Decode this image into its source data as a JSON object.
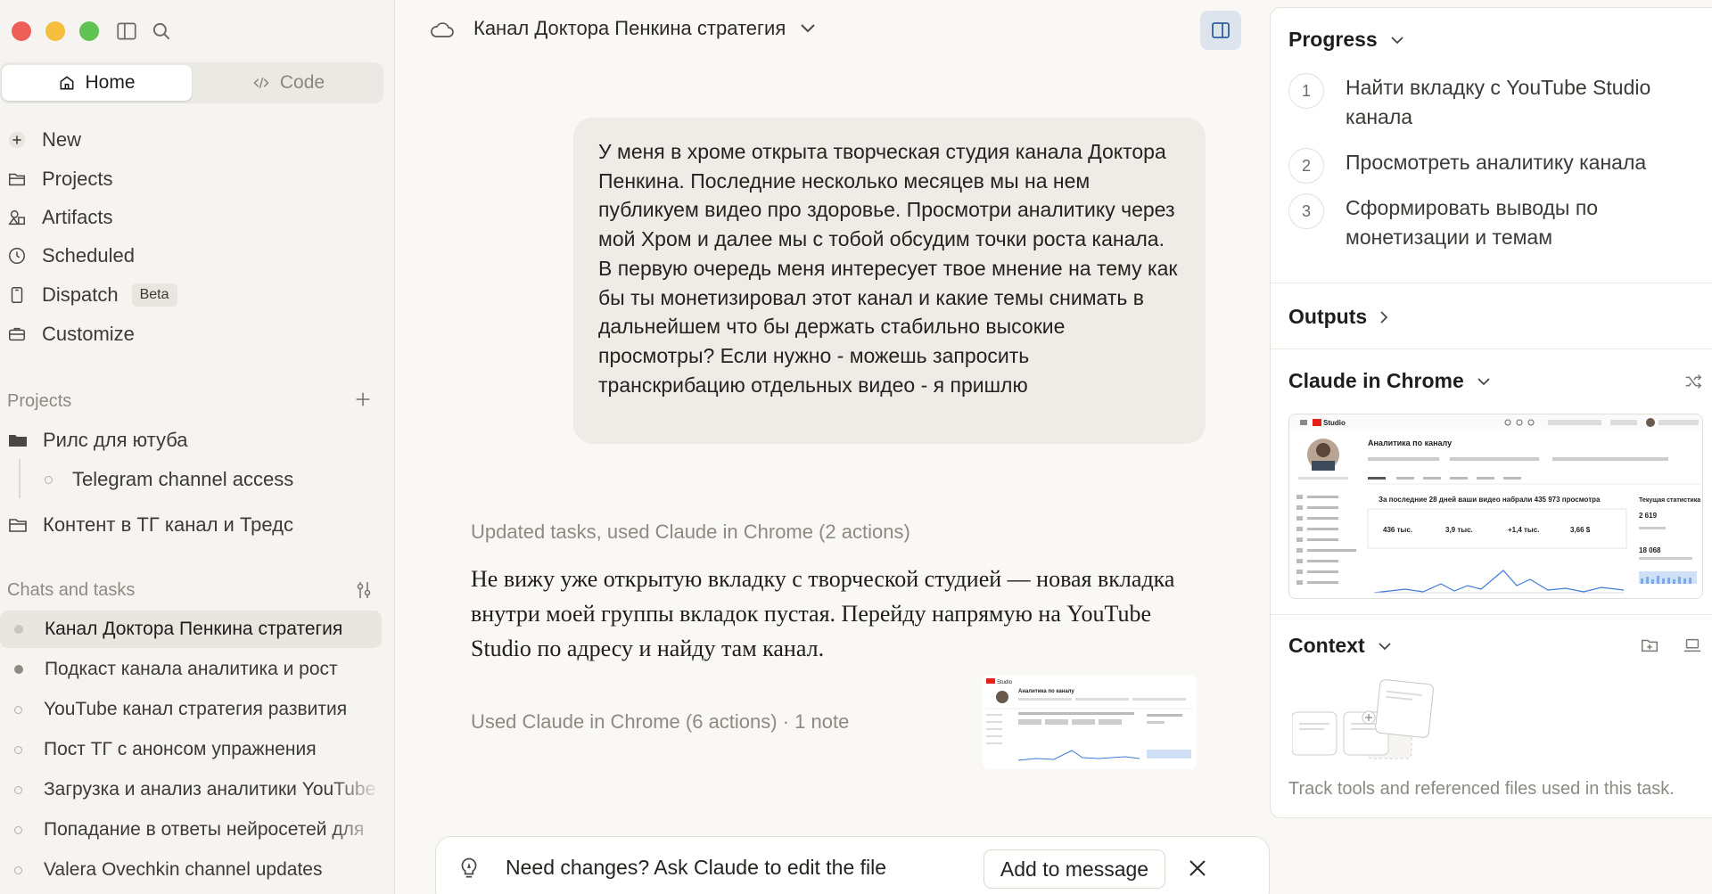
{
  "sidebar": {
    "mode": {
      "home": "Home",
      "code": "Code"
    },
    "nav": [
      {
        "label": "New",
        "icon": "plus-icon"
      },
      {
        "label": "Projects",
        "icon": "folder-icon"
      },
      {
        "label": "Artifacts",
        "icon": "shapes-icon"
      },
      {
        "label": "Scheduled",
        "icon": "clock-icon"
      },
      {
        "label": "Dispatch",
        "icon": "phone-icon",
        "badge": "Beta"
      },
      {
        "label": "Customize",
        "icon": "briefcase-icon"
      }
    ],
    "projects_label": "Projects",
    "projects": [
      {
        "label": "Рилс для ютуба"
      },
      {
        "label": "Telegram channel access"
      },
      {
        "label": "Контент в ТГ канал и Тредс"
      }
    ],
    "chats_label": "Chats and tasks",
    "chats": [
      {
        "label": "Канал Доктора Пенкина стратегия"
      },
      {
        "label": "Подкаст канала аналитика и рост"
      },
      {
        "label": "YouTube канал стратегия развития"
      },
      {
        "label": "Пост ТГ с анонсом упражнения"
      },
      {
        "label": "Загрузка и анализ аналитики YouTube"
      },
      {
        "label": "Попадание в ответы нейросетей для"
      },
      {
        "label": "Valera Ovechkin channel updates"
      }
    ]
  },
  "main": {
    "title": "Канал Доктора Пенкина стратегия",
    "user_message": "У меня в хроме открыта творческая студия канала Доктора Пенкина. Последние несколько месяцев мы на нем публикуем видео про здоровье. Просмотри аналитику через мой Хром и далее мы с тобой обсудим точки роста канала. В первую очередь меня интересует твое мнение на тему как бы ты монетизировал этот канал и какие темы снимать в дальнейшем что бы держать стабильно высокие просмотры? Если нужно - можешь запросить транскрибацию отдельных видео - я пришлю",
    "status_1": "Updated tasks, used Claude in Chrome (2 actions)",
    "assistant_message": "Не вижу уже открытую вкладку с творческой студией — новая вкладка внутри моей группы вкладок пустая. Перейду напрямую на YouTube Studio по адресу и найду там канал.",
    "status_2": "Used Claude in Chrome (6 actions) · 1 note",
    "suggestion": "Need changes? Ask Claude to edit the file",
    "add_button": "Add to message"
  },
  "right_panel": {
    "progress_title": "Progress",
    "steps": [
      {
        "num": "1",
        "text": "Найти вкладку с YouTube Studio канала"
      },
      {
        "num": "2",
        "text": "Просмотреть аналитику канала"
      },
      {
        "num": "3",
        "text": "Сформировать выводы по монетизации и темам"
      }
    ],
    "outputs_title": "Outputs",
    "chrome_title": "Claude in Chrome",
    "context_title": "Context",
    "context_hint": "Track tools and referenced files used in this task."
  },
  "screenshot": {
    "page_title": "Аналитика по каналу",
    "summary": "За последние 28 дней ваши видео набрали 435 973 просмотра",
    "stats": [
      "436 тыс.",
      "3,9 тыс.",
      "+1,4 тыс.",
      "3,66 $"
    ],
    "side_title": "Текущая статистика",
    "side_value_1": "2 619",
    "side_value_2": "18 068",
    "brand": "Studio"
  },
  "colors": {
    "accent_blue": "#dde4ee",
    "close": "#ee5f57",
    "minimize": "#f5be3c",
    "maximize": "#5fc454"
  }
}
